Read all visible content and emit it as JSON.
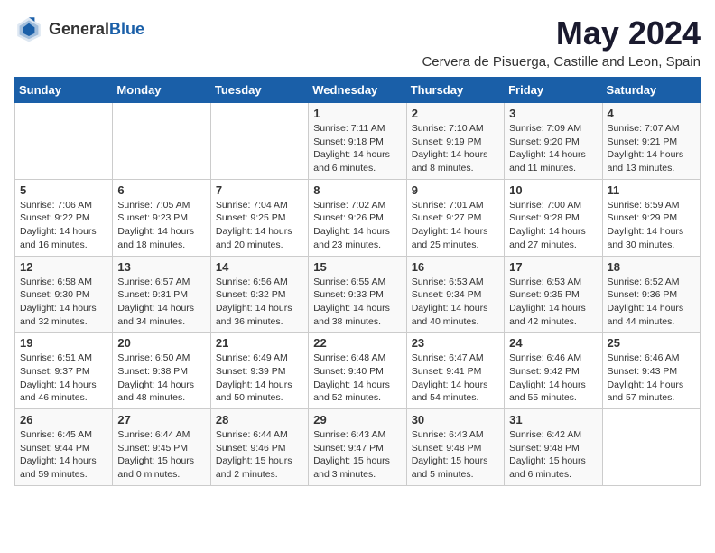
{
  "header": {
    "logo_general": "General",
    "logo_blue": "Blue",
    "month_title": "May 2024",
    "location": "Cervera de Pisuerga, Castille and Leon, Spain"
  },
  "calendar": {
    "days_of_week": [
      "Sunday",
      "Monday",
      "Tuesday",
      "Wednesday",
      "Thursday",
      "Friday",
      "Saturday"
    ],
    "weeks": [
      [
        {
          "day": "",
          "content": ""
        },
        {
          "day": "",
          "content": ""
        },
        {
          "day": "",
          "content": ""
        },
        {
          "day": "1",
          "content": "Sunrise: 7:11 AM\nSunset: 9:18 PM\nDaylight: 14 hours and 6 minutes."
        },
        {
          "day": "2",
          "content": "Sunrise: 7:10 AM\nSunset: 9:19 PM\nDaylight: 14 hours and 8 minutes."
        },
        {
          "day": "3",
          "content": "Sunrise: 7:09 AM\nSunset: 9:20 PM\nDaylight: 14 hours and 11 minutes."
        },
        {
          "day": "4",
          "content": "Sunrise: 7:07 AM\nSunset: 9:21 PM\nDaylight: 14 hours and 13 minutes."
        }
      ],
      [
        {
          "day": "5",
          "content": "Sunrise: 7:06 AM\nSunset: 9:22 PM\nDaylight: 14 hours and 16 minutes."
        },
        {
          "day": "6",
          "content": "Sunrise: 7:05 AM\nSunset: 9:23 PM\nDaylight: 14 hours and 18 minutes."
        },
        {
          "day": "7",
          "content": "Sunrise: 7:04 AM\nSunset: 9:25 PM\nDaylight: 14 hours and 20 minutes."
        },
        {
          "day": "8",
          "content": "Sunrise: 7:02 AM\nSunset: 9:26 PM\nDaylight: 14 hours and 23 minutes."
        },
        {
          "day": "9",
          "content": "Sunrise: 7:01 AM\nSunset: 9:27 PM\nDaylight: 14 hours and 25 minutes."
        },
        {
          "day": "10",
          "content": "Sunrise: 7:00 AM\nSunset: 9:28 PM\nDaylight: 14 hours and 27 minutes."
        },
        {
          "day": "11",
          "content": "Sunrise: 6:59 AM\nSunset: 9:29 PM\nDaylight: 14 hours and 30 minutes."
        }
      ],
      [
        {
          "day": "12",
          "content": "Sunrise: 6:58 AM\nSunset: 9:30 PM\nDaylight: 14 hours and 32 minutes."
        },
        {
          "day": "13",
          "content": "Sunrise: 6:57 AM\nSunset: 9:31 PM\nDaylight: 14 hours and 34 minutes."
        },
        {
          "day": "14",
          "content": "Sunrise: 6:56 AM\nSunset: 9:32 PM\nDaylight: 14 hours and 36 minutes."
        },
        {
          "day": "15",
          "content": "Sunrise: 6:55 AM\nSunset: 9:33 PM\nDaylight: 14 hours and 38 minutes."
        },
        {
          "day": "16",
          "content": "Sunrise: 6:53 AM\nSunset: 9:34 PM\nDaylight: 14 hours and 40 minutes."
        },
        {
          "day": "17",
          "content": "Sunrise: 6:53 AM\nSunset: 9:35 PM\nDaylight: 14 hours and 42 minutes."
        },
        {
          "day": "18",
          "content": "Sunrise: 6:52 AM\nSunset: 9:36 PM\nDaylight: 14 hours and 44 minutes."
        }
      ],
      [
        {
          "day": "19",
          "content": "Sunrise: 6:51 AM\nSunset: 9:37 PM\nDaylight: 14 hours and 46 minutes."
        },
        {
          "day": "20",
          "content": "Sunrise: 6:50 AM\nSunset: 9:38 PM\nDaylight: 14 hours and 48 minutes."
        },
        {
          "day": "21",
          "content": "Sunrise: 6:49 AM\nSunset: 9:39 PM\nDaylight: 14 hours and 50 minutes."
        },
        {
          "day": "22",
          "content": "Sunrise: 6:48 AM\nSunset: 9:40 PM\nDaylight: 14 hours and 52 minutes."
        },
        {
          "day": "23",
          "content": "Sunrise: 6:47 AM\nSunset: 9:41 PM\nDaylight: 14 hours and 54 minutes."
        },
        {
          "day": "24",
          "content": "Sunrise: 6:46 AM\nSunset: 9:42 PM\nDaylight: 14 hours and 55 minutes."
        },
        {
          "day": "25",
          "content": "Sunrise: 6:46 AM\nSunset: 9:43 PM\nDaylight: 14 hours and 57 minutes."
        }
      ],
      [
        {
          "day": "26",
          "content": "Sunrise: 6:45 AM\nSunset: 9:44 PM\nDaylight: 14 hours and 59 minutes."
        },
        {
          "day": "27",
          "content": "Sunrise: 6:44 AM\nSunset: 9:45 PM\nDaylight: 15 hours and 0 minutes."
        },
        {
          "day": "28",
          "content": "Sunrise: 6:44 AM\nSunset: 9:46 PM\nDaylight: 15 hours and 2 minutes."
        },
        {
          "day": "29",
          "content": "Sunrise: 6:43 AM\nSunset: 9:47 PM\nDaylight: 15 hours and 3 minutes."
        },
        {
          "day": "30",
          "content": "Sunrise: 6:43 AM\nSunset: 9:48 PM\nDaylight: 15 hours and 5 minutes."
        },
        {
          "day": "31",
          "content": "Sunrise: 6:42 AM\nSunset: 9:48 PM\nDaylight: 15 hours and 6 minutes."
        },
        {
          "day": "",
          "content": ""
        }
      ]
    ]
  }
}
